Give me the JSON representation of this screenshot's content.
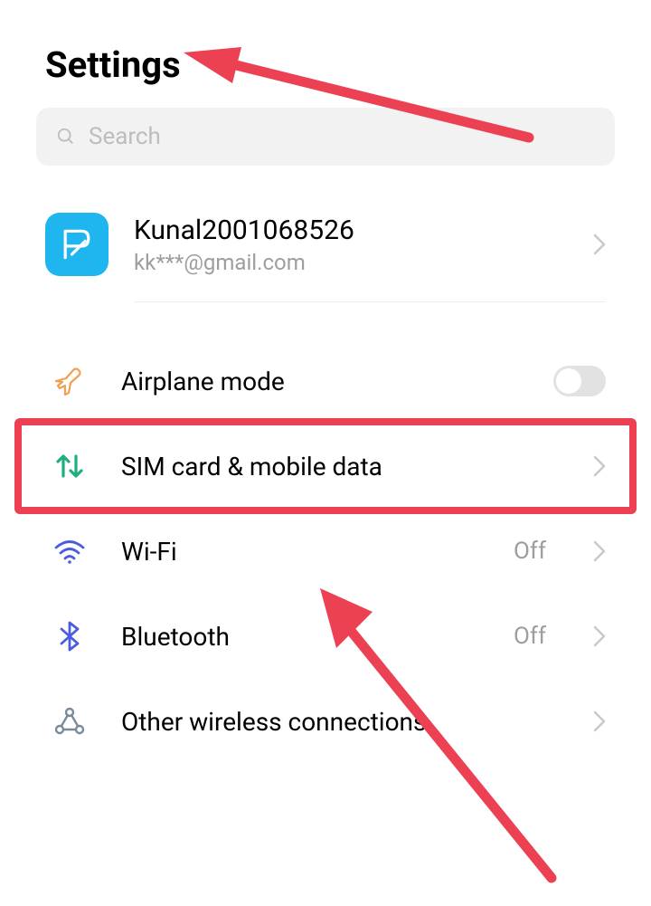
{
  "header": {
    "title": "Settings"
  },
  "search": {
    "placeholder": "Search"
  },
  "account": {
    "name": "Kunal2001068526",
    "email": "kk***@gmail.com"
  },
  "items": {
    "airplane": {
      "label": "Airplane mode",
      "toggle": false
    },
    "sim": {
      "label": "SIM card & mobile data"
    },
    "wifi": {
      "label": "Wi-Fi",
      "status": "Off"
    },
    "bluetooth": {
      "label": "Bluetooth",
      "status": "Off"
    },
    "other": {
      "label": "Other wireless connections"
    }
  },
  "annotations": {
    "highlight_target": "sim",
    "arrow1_color": "#ec4053",
    "arrow2_color": "#ec4053"
  }
}
